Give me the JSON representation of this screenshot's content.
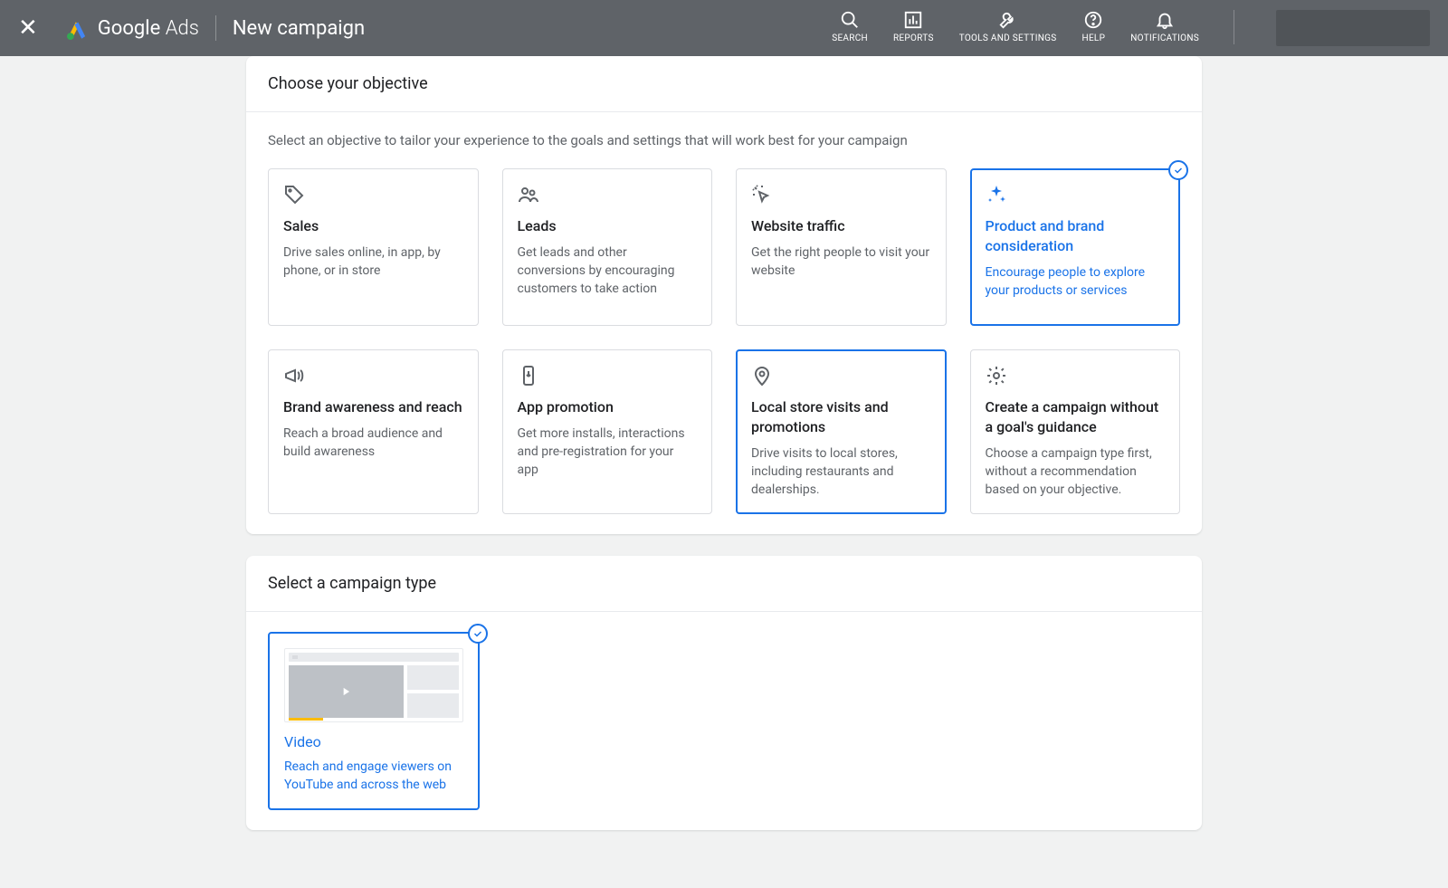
{
  "header": {
    "brand_google": "Google",
    "brand_ads": "Ads",
    "page_title": "New campaign",
    "nav": {
      "search": "SEARCH",
      "reports": "REPORTS",
      "tools": "TOOLS AND SETTINGS",
      "help": "HELP",
      "notifications": "NOTIFICATIONS"
    }
  },
  "objective_panel": {
    "heading": "Choose your objective",
    "subtext": "Select an objective to tailor your experience to the goals and settings that will work best for your campaign",
    "cards": [
      {
        "title": "Sales",
        "desc": "Drive sales online, in app, by phone, or in store"
      },
      {
        "title": "Leads",
        "desc": "Get leads and other conversions by encouraging customers to take action"
      },
      {
        "title": "Website traffic",
        "desc": "Get the right people to visit your website"
      },
      {
        "title": "Product and brand consideration",
        "desc": "Encourage people to explore your products or services"
      },
      {
        "title": "Brand awareness and reach",
        "desc": "Reach a broad audience and build awareness"
      },
      {
        "title": "App promotion",
        "desc": "Get more installs, interactions and pre-registration for your app"
      },
      {
        "title": "Local store visits and promotions",
        "desc": "Drive visits to local stores, including restaurants and dealerships."
      },
      {
        "title": "Create a campaign without a goal's guidance",
        "desc": "Choose a campaign type first, without a recommendation based on your objective."
      }
    ]
  },
  "campaign_type_panel": {
    "heading": "Select a campaign type",
    "cards": [
      {
        "title": "Video",
        "desc": "Reach and engage viewers on YouTube and across the web"
      }
    ]
  }
}
